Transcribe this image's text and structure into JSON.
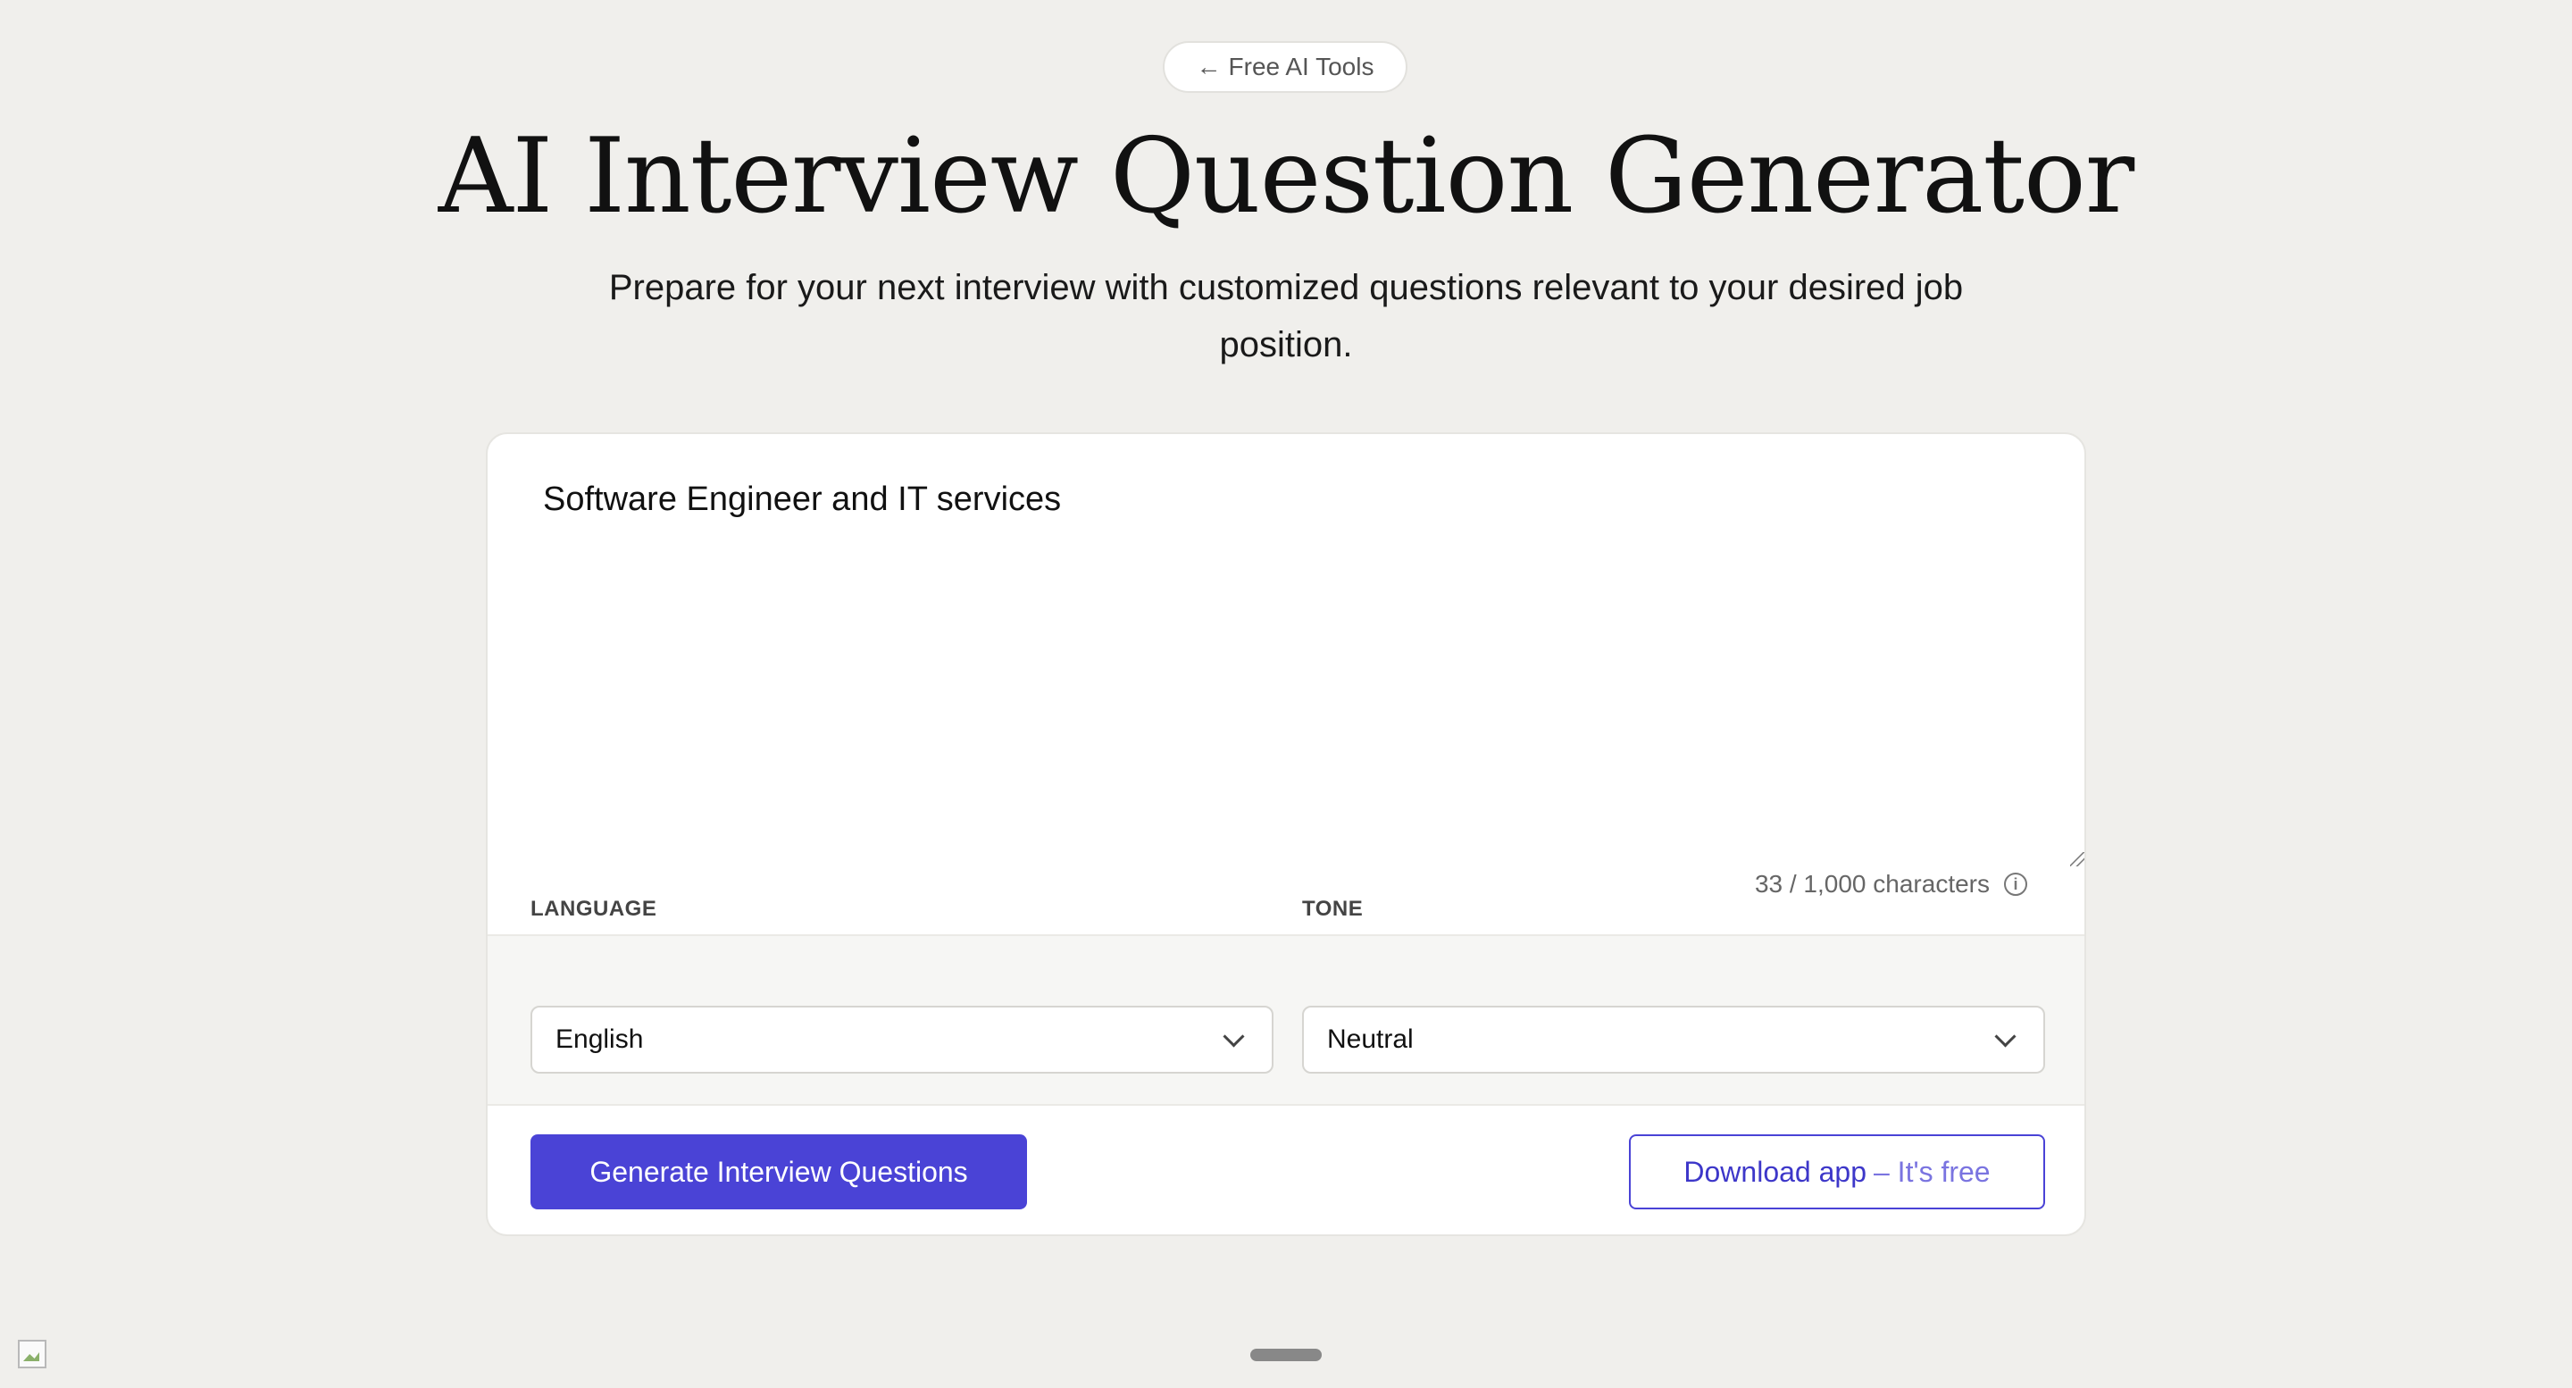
{
  "nav": {
    "back_arrow": "←",
    "back_label": "Free AI Tools"
  },
  "header": {
    "title": "AI Interview Question Generator",
    "subtitle": "Prepare for your next interview with customized questions relevant to your desired job position."
  },
  "form": {
    "job_input_value": "Software Engineer and IT services",
    "char_count": "33 / 1,000 characters",
    "info_icon": "info-icon",
    "language": {
      "label": "LANGUAGE",
      "selected": "English"
    },
    "tone": {
      "label": "TONE",
      "selected": "Neutral"
    },
    "generate_label": "Generate Interview Questions",
    "download_main": "Download app",
    "download_free": "– It's free"
  },
  "colors": {
    "background": "#f0efec",
    "accent": "#4a43d6",
    "card": "#ffffff"
  }
}
